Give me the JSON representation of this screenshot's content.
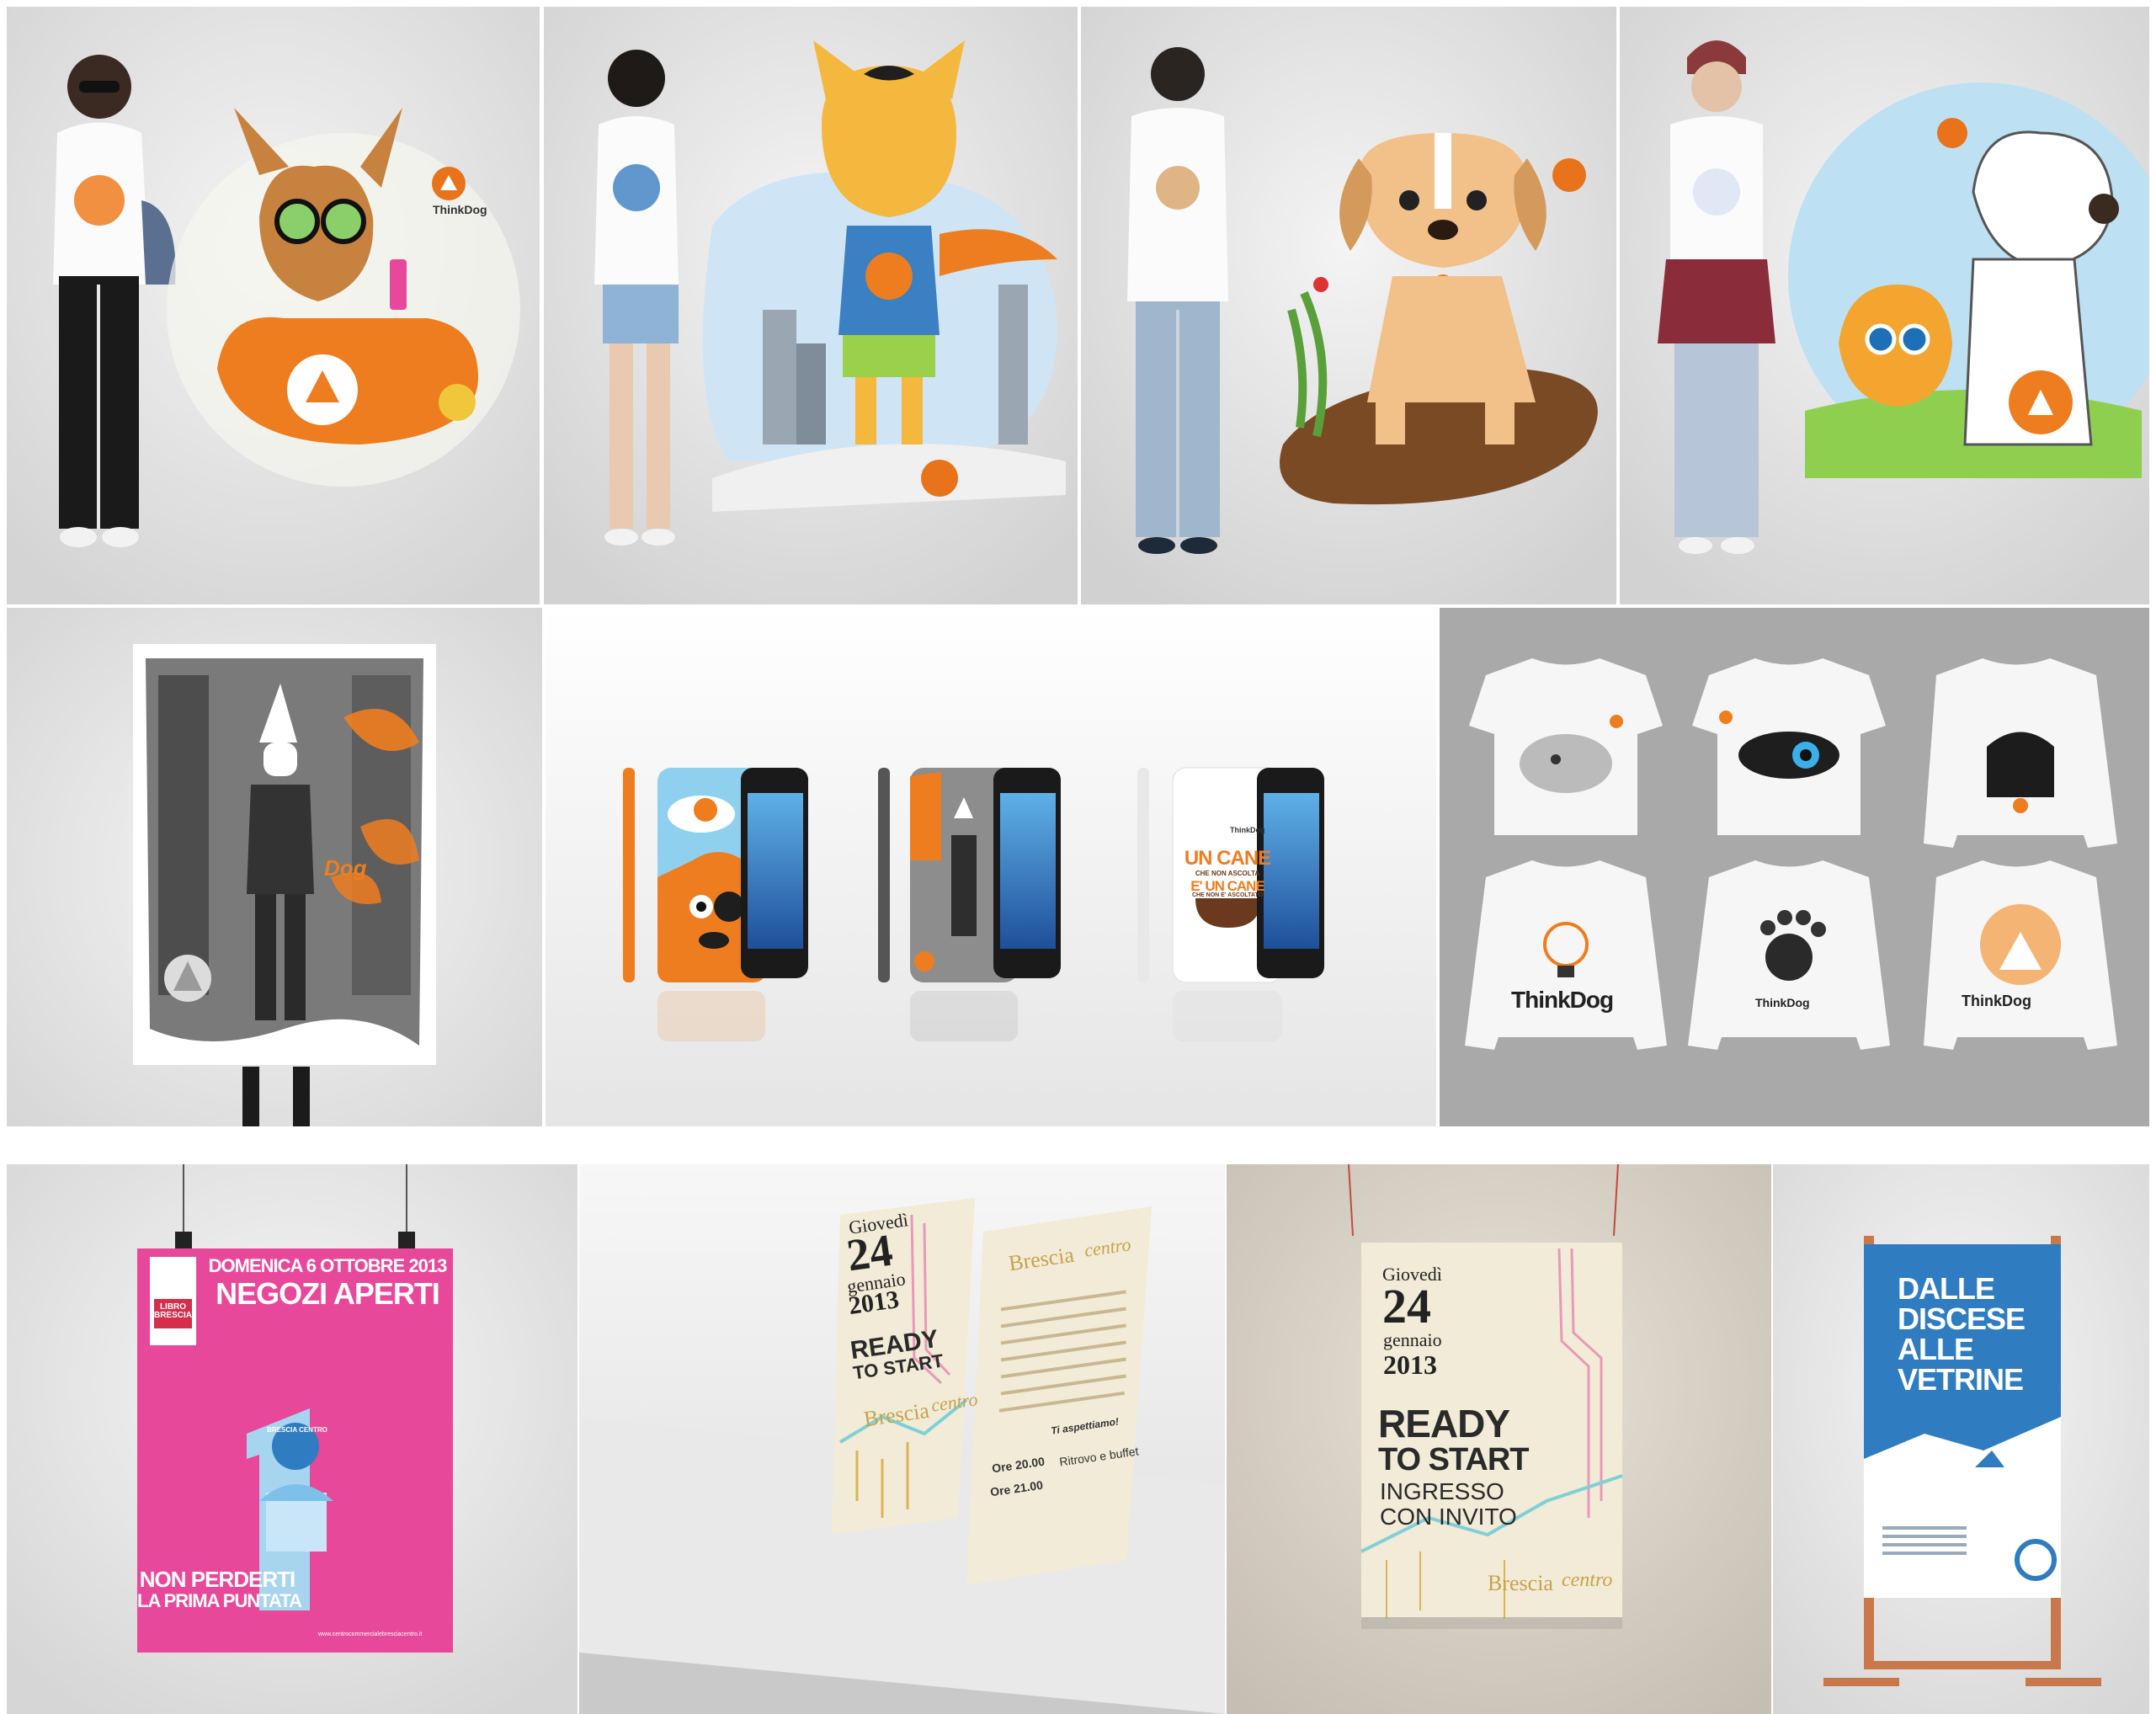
{
  "brand": {
    "name": "ThinkDog",
    "accent": "#e8731a",
    "logo_words": [
      "Think",
      "Dog"
    ]
  },
  "colors": {
    "orange": "#ee7d1f",
    "pink": "#e8489a",
    "blue": "#2f7dc0",
    "cream": "#f1ebd7",
    "copper": "#c8784a"
  },
  "phone_case_text": {
    "line1": "UN CANE",
    "line2": "CHE NON ASCOLTA",
    "line3": "E' UN CANE",
    "line4": "CHE NON E' ASCOLTATO"
  },
  "negozi_poster": {
    "date_line": "DOMENICA 6 OTTOBRE 2013",
    "headline": "NEGOZI APERTI",
    "badge": "LIBRO BRESCIA",
    "center_logo": "BRESCIA CENTRO",
    "bottom_line1": "NON PERDERTI",
    "bottom_line2": "LA PRIMA PUNTATA",
    "website": "www.centrocommercialebresciacentro.it"
  },
  "flyer": {
    "weekday": "Giovedì",
    "day": "24",
    "month": "gennaio",
    "year": "2013",
    "title1": "READY",
    "title2": "TO START",
    "brand_a": "Brescia",
    "brand_b": "centro",
    "time1": "Ore 20.00",
    "event1": "Ritrovo e buffet",
    "time2": "Ore 21.00",
    "closing": "Ti aspettiamo!"
  },
  "hanging_poster": {
    "weekday": "Giovedì",
    "day": "24",
    "month": "gennaio",
    "year": "2013",
    "title1": "READY",
    "title2": "TO START",
    "sub1": "INGRESSO",
    "sub2": "CON INVITO",
    "brand_a": "Brescia",
    "brand_b": "centro"
  },
  "ski_poster": {
    "line1": "DALLE",
    "line2": "DISCESE",
    "line3": "ALLE",
    "line4": "VETRINE"
  }
}
